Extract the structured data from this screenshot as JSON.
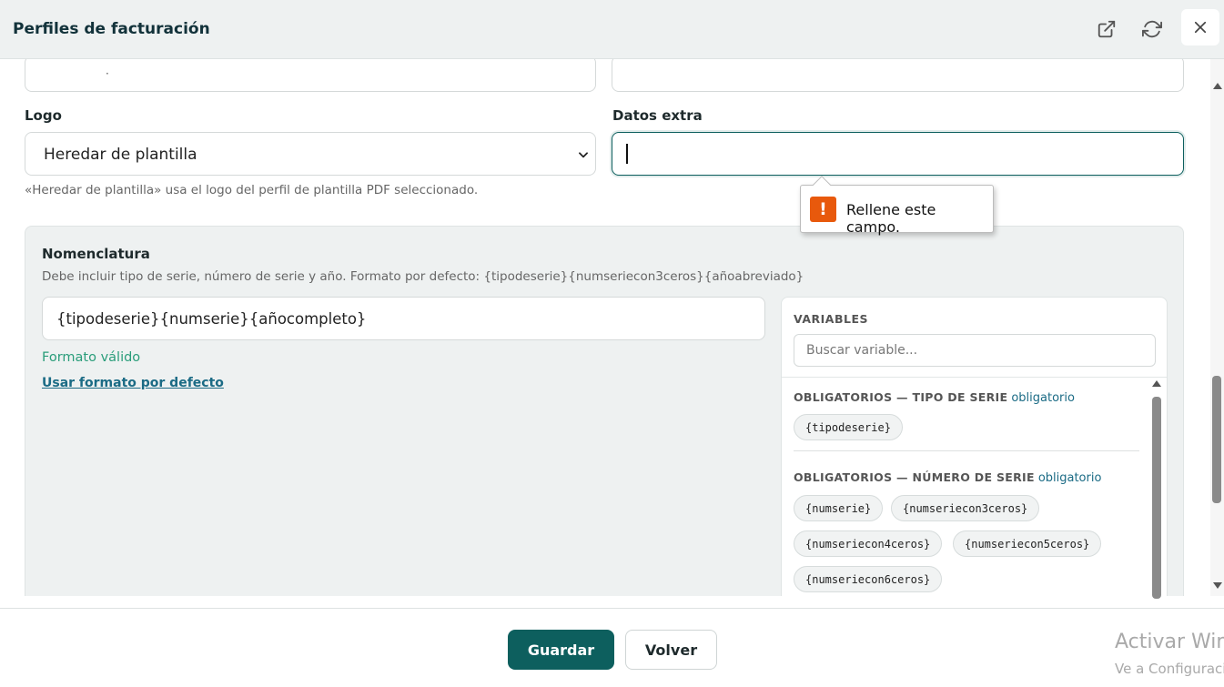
{
  "header": {
    "title": "Perfiles de facturación",
    "icons": {
      "external": "external-link-icon",
      "refresh": "refresh-icon",
      "close": "close-icon"
    }
  },
  "form": {
    "logo_label": "Logo",
    "logo_select_value": "Heredar de plantilla",
    "logo_hint": "«Heredar de plantilla» usa el logo del perfil de plantilla PDF seleccionado.",
    "extra_label": "Datos extra",
    "extra_value": ""
  },
  "tooltip": {
    "text": "Rellene este campo.",
    "icon": "warning-icon"
  },
  "nomenclature": {
    "title": "Nomenclatura",
    "description": "Debe incluir tipo de serie, número de serie y año. Formato por defecto: {tipodeserie}{numseriecon3ceros}{añoabreviado}",
    "value": "{tipodeserie}{numserie}{añocompleto}",
    "status": "Formato válido",
    "default_link": "Usar formato por defecto"
  },
  "variables": {
    "title": "VARIABLES",
    "search_placeholder": "Buscar variable...",
    "groups": [
      {
        "title": "OBLIGATORIOS — TIPO DE SERIE",
        "tag": "obligatorio",
        "chips": [
          "{tipodeserie}"
        ]
      },
      {
        "title": "OBLIGATORIOS — NÚMERO DE SERIE",
        "tag": "obligatorio",
        "chips": [
          "{numserie}",
          "{numseriecon3ceros}",
          "{numseriecon4ceros}",
          "{numseriecon5ceros}",
          "{numseriecon6ceros}"
        ]
      }
    ]
  },
  "footer": {
    "save_label": "Guardar",
    "back_label": "Volver"
  },
  "watermark": {
    "line1": "Activar Windows",
    "line2": "Ve a Configuración"
  },
  "colors": {
    "primary": "#0d5f5e",
    "valid": "#2a9d7a",
    "link": "#1b6b85",
    "warning": "#e8590c"
  }
}
